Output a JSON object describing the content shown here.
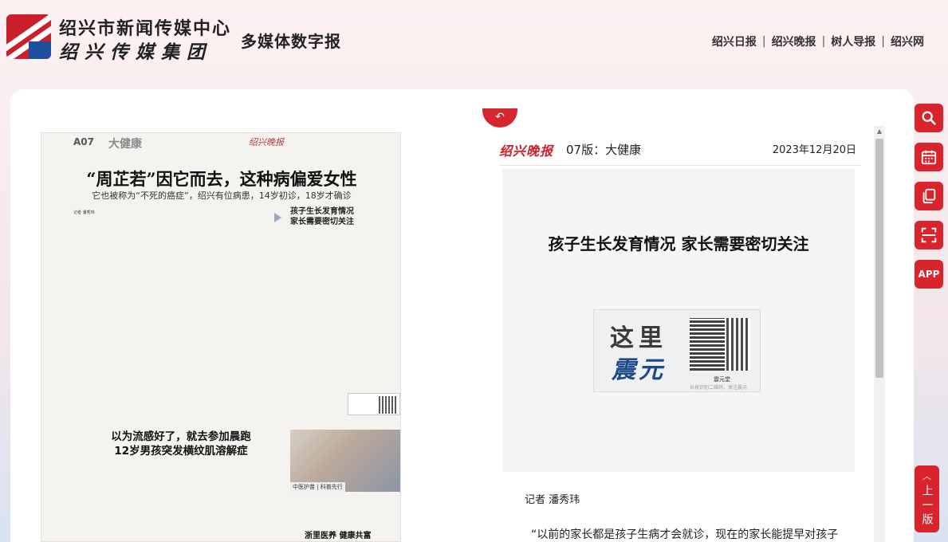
{
  "header": {
    "org_line1": "绍兴市新闻传媒中心",
    "org_line2": "绍兴传媒集团",
    "site_title": "多媒体数字报",
    "nav": [
      "绍兴日报",
      "绍兴晚报",
      "树人导报",
      "绍兴网"
    ],
    "brand_colors": {
      "red": "#c9202b",
      "blue": "#1d4f9c"
    }
  },
  "paper": {
    "page_no": "A07",
    "section": "大健康",
    "masthead": "绍兴晚报",
    "headline": "“周芷若”因它而去，这种病偏爱女性",
    "subhead": "它也被称为“不死的癌症”，绍兴有位病患，14岁初诊，18岁才确诊",
    "byline": "记者 潘秀玮",
    "side_headline_1": "孩子生长发育情况",
    "side_headline_2": "家长需要密切关注",
    "headline2_line1": "以为流感好了，就去参加晨跑",
    "headline2_line2": "12岁男孩突发横纹肌溶解症",
    "photo_tag": "中医护苗 | 科普先行",
    "headline3": "浙里医养  健康共富"
  },
  "article": {
    "back_icon": "undo-arrow-icon",
    "logo": "绍兴晚报",
    "page_label": "07版：大健康",
    "date": "2023年12月20日",
    "title": "孩子生长发育情况 家长需要密切关注",
    "banner": {
      "line1": "这里",
      "line2": "震元",
      "qr_name": "震元堂",
      "note": "长按识别二维码，关注震元"
    },
    "reporter": "记者 潘秀玮",
    "quote": "“以前的家长都是孩子生病才会就诊，现在的家长能提早对孩子"
  },
  "tools": [
    {
      "name": "search-icon"
    },
    {
      "name": "calendar-icon"
    },
    {
      "name": "copy-icon"
    },
    {
      "name": "scan-icon"
    },
    {
      "name": "app-icon",
      "label": "APP"
    }
  ],
  "prev_page": {
    "label": "上一版"
  }
}
